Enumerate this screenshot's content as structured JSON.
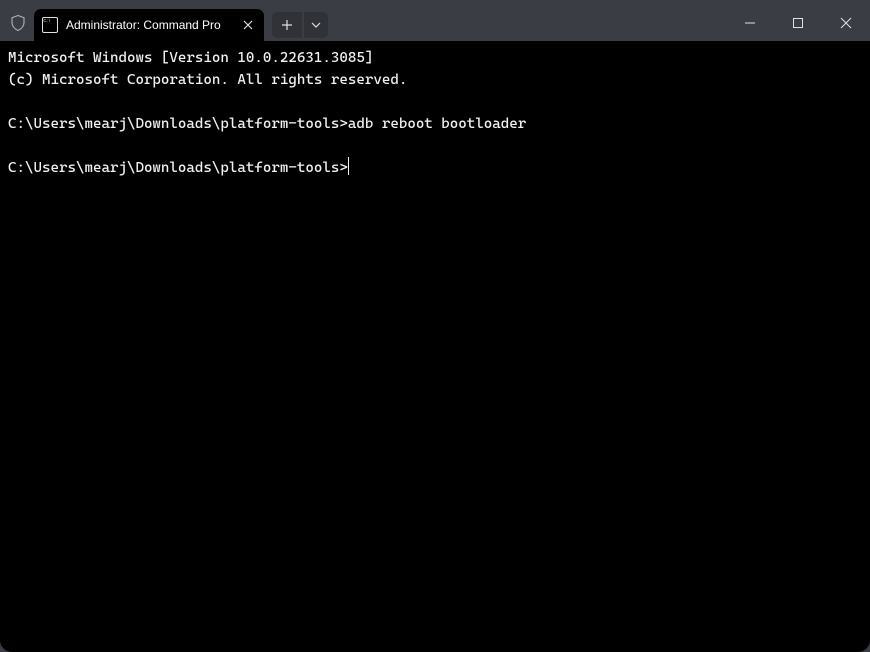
{
  "tab": {
    "title": "Administrator: Command Pro"
  },
  "terminal": {
    "line1": "Microsoft Windows [Version 10.0.22631.3085]",
    "line2": "(c) Microsoft Corporation. All rights reserved.",
    "blank1": "",
    "prompt1": "C:\\Users\\mearj\\Downloads\\platform-tools>",
    "command1": "adb reboot bootloader",
    "blank2": "",
    "prompt2": "C:\\Users\\mearj\\Downloads\\platform-tools>"
  }
}
